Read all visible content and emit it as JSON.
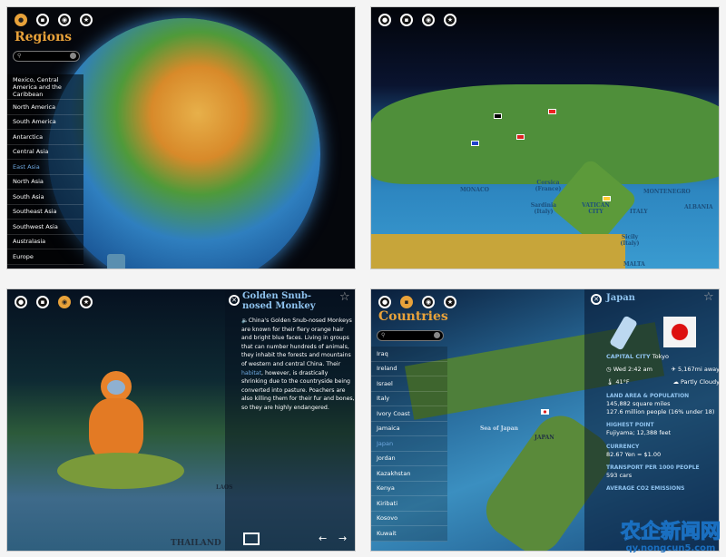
{
  "panel_regions": {
    "nav_icons": [
      "globe-icon",
      "flag-icon",
      "eye-icon",
      "star-icon"
    ],
    "title": "Regions",
    "search_placeholder": "",
    "items": [
      "Mexico, Central America and the Caribbean",
      "North America",
      "South America",
      "Antarctica",
      "Central Asia",
      "East Asia",
      "North Asia",
      "South Asia",
      "Southeast Asia",
      "Southwest Asia",
      "Australasia",
      "Europe"
    ],
    "selected": "East Asia"
  },
  "panel_map": {
    "labels": [
      "MONACO",
      "Corsica (France)",
      "Sardinia (Italy)",
      "VATICAN CITY",
      "ITALY",
      "Sicily (Italy)",
      "MALTA",
      "ALBANIA",
      "MONTENEGRO"
    ]
  },
  "panel_animal": {
    "title": "Golden Snub-nosed Monkey",
    "description_before": "China's Golden Snub-nosed Monkeys are known for their fiery orange hair and bright blue faces. Living in groups that can number hundreds of animals, they inhabit the forests and mountains of western and central China. Their ",
    "link": "habitat",
    "description_after": ", however, is drastically shrinking due to the countryside being converted into pasture. Poachers are also killing them for their fur and bones, so they are highly endangered.",
    "map_labels": [
      "LAOS",
      "THAILAND"
    ],
    "prev": "←",
    "next": "→"
  },
  "panel_countries": {
    "title": "Countries",
    "items": [
      "Iraq",
      "Ireland",
      "Israel",
      "Italy",
      "Ivory Coast",
      "Jamaica",
      "Japan",
      "Jordan",
      "Kazakhstan",
      "Kenya",
      "Kiribati",
      "Kosovo",
      "Kuwait"
    ],
    "selected": "Japan",
    "map_labels": [
      "Sea of Japan",
      "JAPAN"
    ],
    "country": {
      "name": "Japan",
      "capital_label": "CAPITAL CITY",
      "capital": "Tokyo",
      "time": "Wed 2:42 am",
      "distance": "5,167mi away",
      "temperature": "41°F",
      "weather": "Partly Cloudy",
      "land_label": "LAND AREA & POPULATION",
      "area": "145,882 square miles",
      "population": "127.6 million people (16% under 18)",
      "highest_label": "HIGHEST POINT",
      "highest": "Fujiyama; 12,388 feet",
      "currency_label": "CURRENCY",
      "currency": "82.67 Yen = $1.00",
      "transport_label": "TRANSPORT PER 1000 PEOPLE",
      "transport": "593 cars",
      "emissions_label": "AVERAGE CO2 EMISSIONS"
    }
  },
  "watermark": {
    "name": "农企新闻网",
    "url": "qy.nongcun5.com"
  },
  "colors": {
    "accent": "#e8a23a",
    "selected": "#6fa8e0",
    "section": "#8fc3ef"
  }
}
